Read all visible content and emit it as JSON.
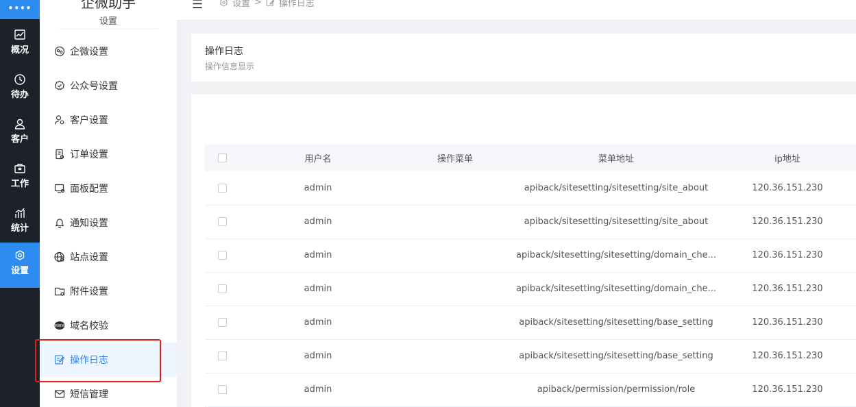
{
  "rail": {
    "logo": "••••",
    "items": [
      {
        "label": "概况",
        "icon": "chart-icon"
      },
      {
        "label": "待办",
        "icon": "clock-icon"
      },
      {
        "label": "客户",
        "icon": "user-icon"
      },
      {
        "label": "工作",
        "icon": "briefcase-icon"
      },
      {
        "label": "统计",
        "icon": "bar-chart-icon"
      },
      {
        "label": "设置",
        "icon": "gear-icon"
      }
    ],
    "active_index": 5,
    "accent": "#2d8cf0"
  },
  "subnav": {
    "title": "企微助手",
    "section": "设置",
    "items": [
      {
        "label": "企微设置",
        "icon": "wecom-icon"
      },
      {
        "label": "公众号设置",
        "icon": "badge-check-icon"
      },
      {
        "label": "客户设置",
        "icon": "user-gear-icon"
      },
      {
        "label": "订单设置",
        "icon": "order-icon"
      },
      {
        "label": "面板配置",
        "icon": "panel-icon"
      },
      {
        "label": "通知设置",
        "icon": "bell-icon"
      },
      {
        "label": "站点设置",
        "icon": "globe-icon"
      },
      {
        "label": "附件设置",
        "icon": "folder-icon"
      },
      {
        "label": "域名校验",
        "icon": "www-icon"
      },
      {
        "label": "操作日志",
        "icon": "edit-log-icon"
      },
      {
        "label": "短信管理",
        "icon": "mail-icon"
      }
    ],
    "active_index": 9
  },
  "topbar": {
    "breadcrumb": [
      "设置",
      ">",
      "操作日志"
    ]
  },
  "header_card": {
    "title": "操作日志",
    "subtitle": "操作信息显示"
  },
  "table": {
    "columns": [
      "",
      "用户名",
      "操作菜单",
      "菜单地址",
      "ip地址"
    ],
    "rows": [
      {
        "user": "admin",
        "menu": "",
        "path": "apiback/sitesetting/sitesetting/site_about",
        "ip": "120.36.151.230"
      },
      {
        "user": "admin",
        "menu": "",
        "path": "apiback/sitesetting/sitesetting/site_about",
        "ip": "120.36.151.230"
      },
      {
        "user": "admin",
        "menu": "",
        "path": "apiback/sitesetting/sitesetting/domain_che...",
        "ip": "120.36.151.230"
      },
      {
        "user": "admin",
        "menu": "",
        "path": "apiback/sitesetting/sitesetting/domain_che...",
        "ip": "120.36.151.230"
      },
      {
        "user": "admin",
        "menu": "",
        "path": "apiback/sitesetting/sitesetting/base_setting",
        "ip": "120.36.151.230"
      },
      {
        "user": "admin",
        "menu": "",
        "path": "apiback/sitesetting/sitesetting/base_setting",
        "ip": "120.36.151.230"
      },
      {
        "user": "admin",
        "menu": "",
        "path": "apiback/permission/permission/role",
        "ip": "120.36.151.230"
      }
    ]
  },
  "colors": {
    "highlight": "#e02020",
    "rail_bg": "#1d2129"
  }
}
